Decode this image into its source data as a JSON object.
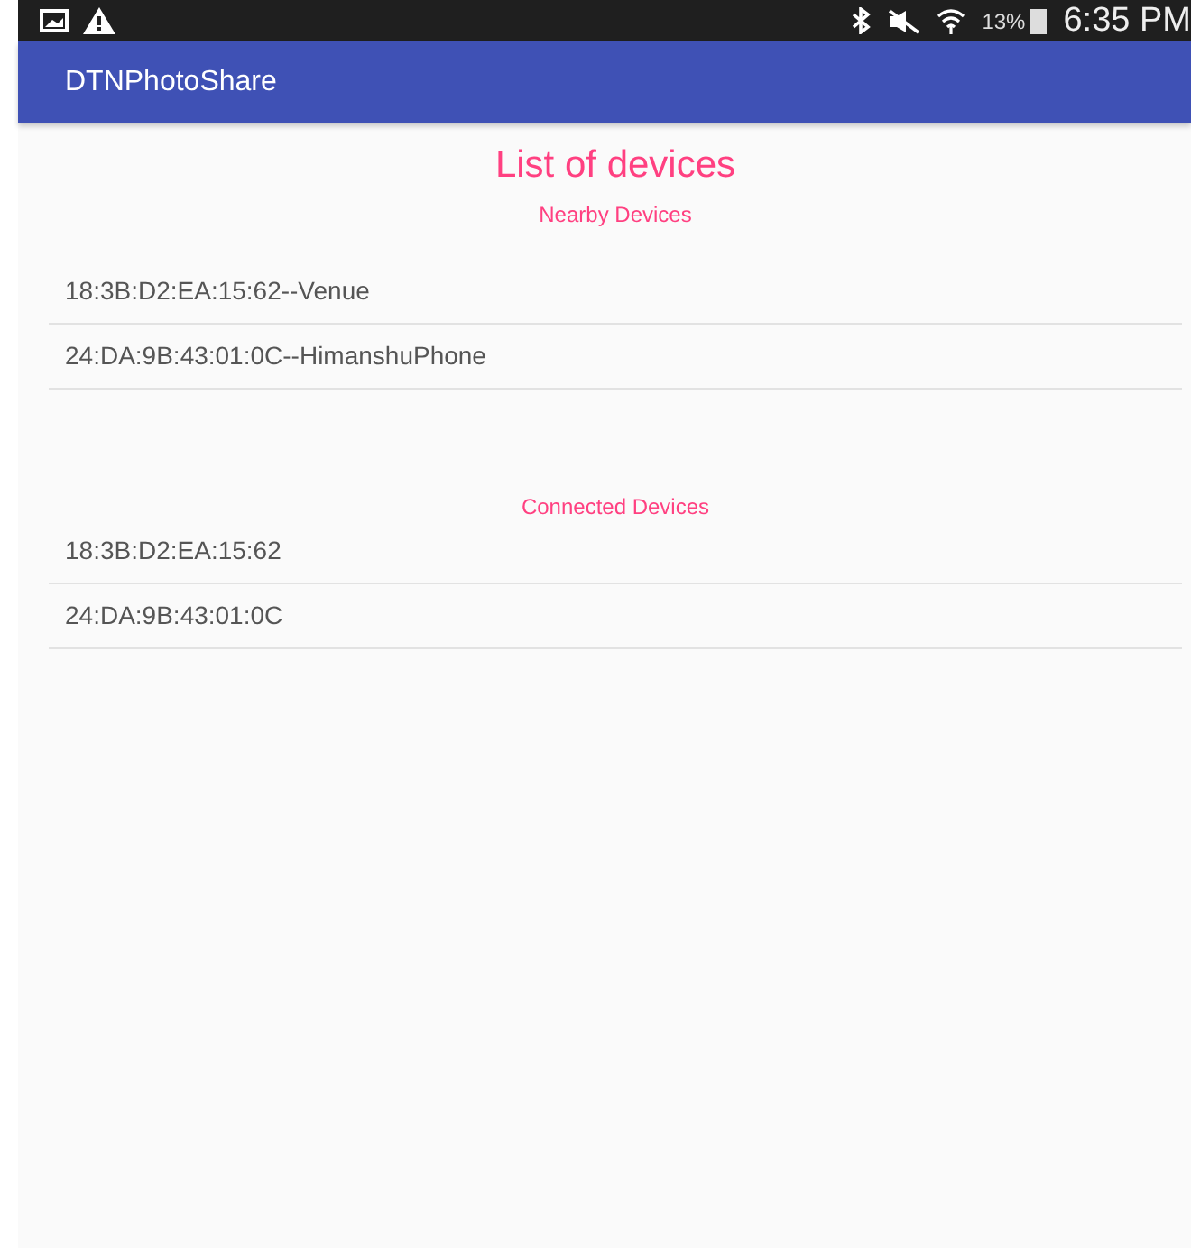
{
  "status_bar": {
    "battery": "13%",
    "time": "6:35 PM"
  },
  "app_bar": {
    "title": "DTNPhotoShare"
  },
  "heading": "List of devices",
  "sections": [
    {
      "title": "Nearby Devices",
      "items": [
        "18:3B:D2:EA:15:62--Venue",
        "24:DA:9B:43:01:0C--HimanshuPhone"
      ]
    },
    {
      "title": "Connected Devices",
      "items": [
        "18:3B:D2:EA:15:62",
        "24:DA:9B:43:01:0C"
      ]
    }
  ]
}
